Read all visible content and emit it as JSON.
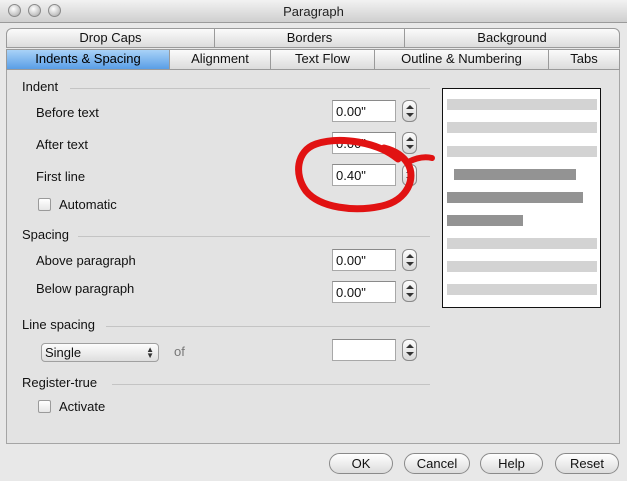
{
  "window": {
    "title": "Paragraph"
  },
  "tabs_row1": [
    {
      "label": "Drop Caps"
    },
    {
      "label": "Borders"
    },
    {
      "label": "Background"
    }
  ],
  "tabs_row2": [
    {
      "label": "Indents & Spacing",
      "active": true
    },
    {
      "label": "Alignment"
    },
    {
      "label": "Text Flow"
    },
    {
      "label": "Outline & Numbering"
    },
    {
      "label": "Tabs"
    }
  ],
  "indent": {
    "heading": "Indent",
    "before_text": {
      "label": "Before text",
      "value": "0.00\""
    },
    "after_text": {
      "label": "After text",
      "value": "0.00\""
    },
    "first_line": {
      "label": "First line",
      "value": "0.40\""
    },
    "automatic": {
      "label": "Automatic",
      "checked": false
    }
  },
  "spacing": {
    "heading": "Spacing",
    "above": {
      "label": "Above paragraph",
      "value": "0.00\""
    },
    "below": {
      "label": "Below paragraph",
      "value": "0.00\""
    }
  },
  "line_spacing": {
    "heading": "Line spacing",
    "selected": "Single",
    "of_label": "of",
    "of_value": ""
  },
  "register_true": {
    "heading": "Register-true",
    "activate": {
      "label": "Activate",
      "checked": false
    }
  },
  "buttons": {
    "ok": "OK",
    "cancel": "Cancel",
    "help": "Help",
    "reset": "Reset"
  },
  "colors": {
    "annotation": "#e11212",
    "active_tab": "#5a9ee6",
    "preview_light": "#d3d3d3",
    "preview_dark": "#939393"
  }
}
